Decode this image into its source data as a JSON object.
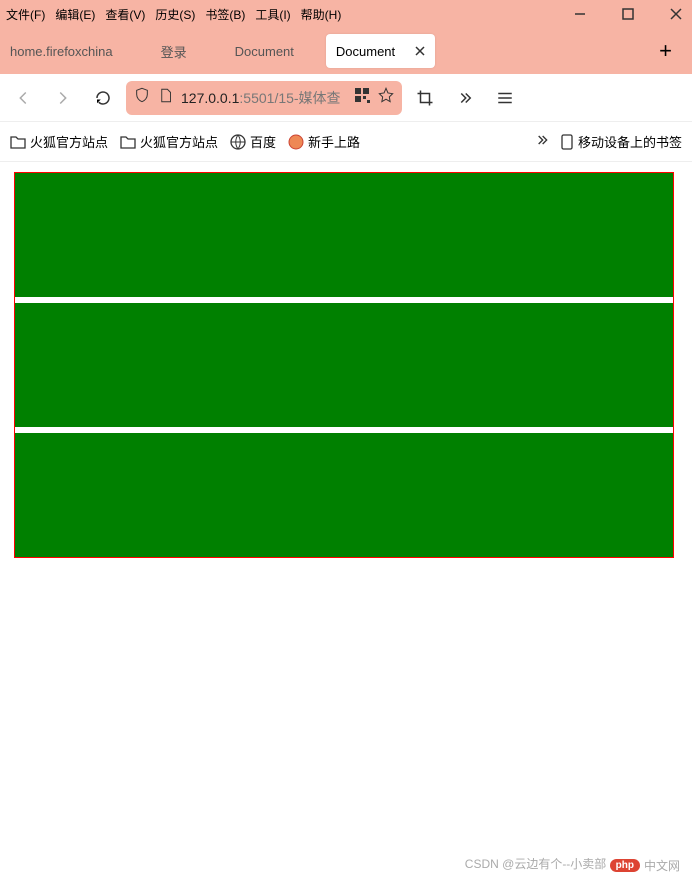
{
  "menu": {
    "file": "文件(F)",
    "edit": "编辑(E)",
    "view": "查看(V)",
    "history": "历史(S)",
    "bookmarks": "书签(B)",
    "tools": "工具(I)",
    "help": "帮助(H)"
  },
  "tabs": {
    "items": [
      "home.firefoxchina",
      "登录",
      "Document"
    ],
    "active": "Document"
  },
  "url": {
    "host": "127.0.0.1",
    "port": ":5501",
    "path": "/15-媒体查"
  },
  "bookmarks": {
    "b1": "火狐官方站点",
    "b2": "火狐官方站点",
    "b3": "百度",
    "b4": "新手上路",
    "mobile": "移动设备上的书签"
  },
  "watermark": {
    "csdn": "CSDN @云边有个--小卖部",
    "cn": "中文网"
  }
}
